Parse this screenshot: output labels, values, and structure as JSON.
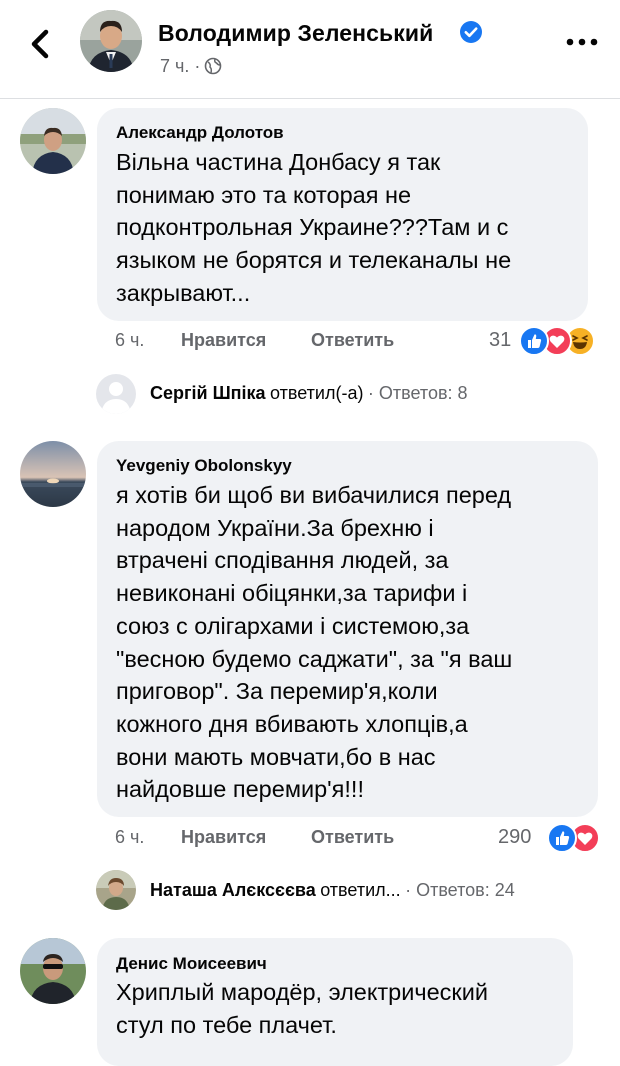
{
  "header": {
    "author_name": "Володимир Зеленський",
    "time": "7 ч. ·",
    "icons": [
      "back-chevron-icon",
      "verified-badge-icon",
      "globe-icon",
      "more-icon"
    ]
  },
  "comments": [
    {
      "author": "Александр Долотов",
      "text": "Вільна частина Донбасу я так\nпонимаю это та которая не\nподконтрольная Украине???Там и с\nязыком не борятся и телеканалы не\nзакрывают...",
      "time": "6 ч.",
      "like_label": "Нравится",
      "reply_label": "Ответить",
      "reactions_count": "31",
      "reactions": [
        "like",
        "love",
        "haha"
      ],
      "reply_summary": {
        "author": "Сергій Шпіка",
        "action": "ответил(-а)",
        "count_text": "· Ответов: 8"
      }
    },
    {
      "author": "Yevgeniy Obolonskyy",
      "text": "я хотів би щоб ви вибачилися перед\nнародом України.За брехню і\nвтрачені сподівання людей, за\nневиконані обіцянки,за тарифи і\nсоюз с олігархами і системою,за\n\"весною будемо саджати\", за \"я ваш\nприговор\". За перемир'я,коли\nкожного дня вбивають хлопців,а\nвони мають мовчати,бо в нас\nнайдовше перемир'я!!!",
      "time": "6 ч.",
      "like_label": "Нравится",
      "reply_label": "Ответить",
      "reactions_count": "290",
      "reactions": [
        "like",
        "love"
      ],
      "reply_summary": {
        "author": "Наташа Алєксєєва",
        "action": "ответил...",
        "count_text": "· Ответов: 24"
      }
    },
    {
      "author": "Денис Моисеевич",
      "text": "Хриплый мародёр, электрический\nстул по тебе плачет."
    }
  ],
  "colors": {
    "link_blue": "#1877f2",
    "love_red": "#f33e58",
    "haha_yellow": "#f7b125",
    "bubble_bg": "#f0f2f5",
    "secondary_text": "#65676b"
  }
}
